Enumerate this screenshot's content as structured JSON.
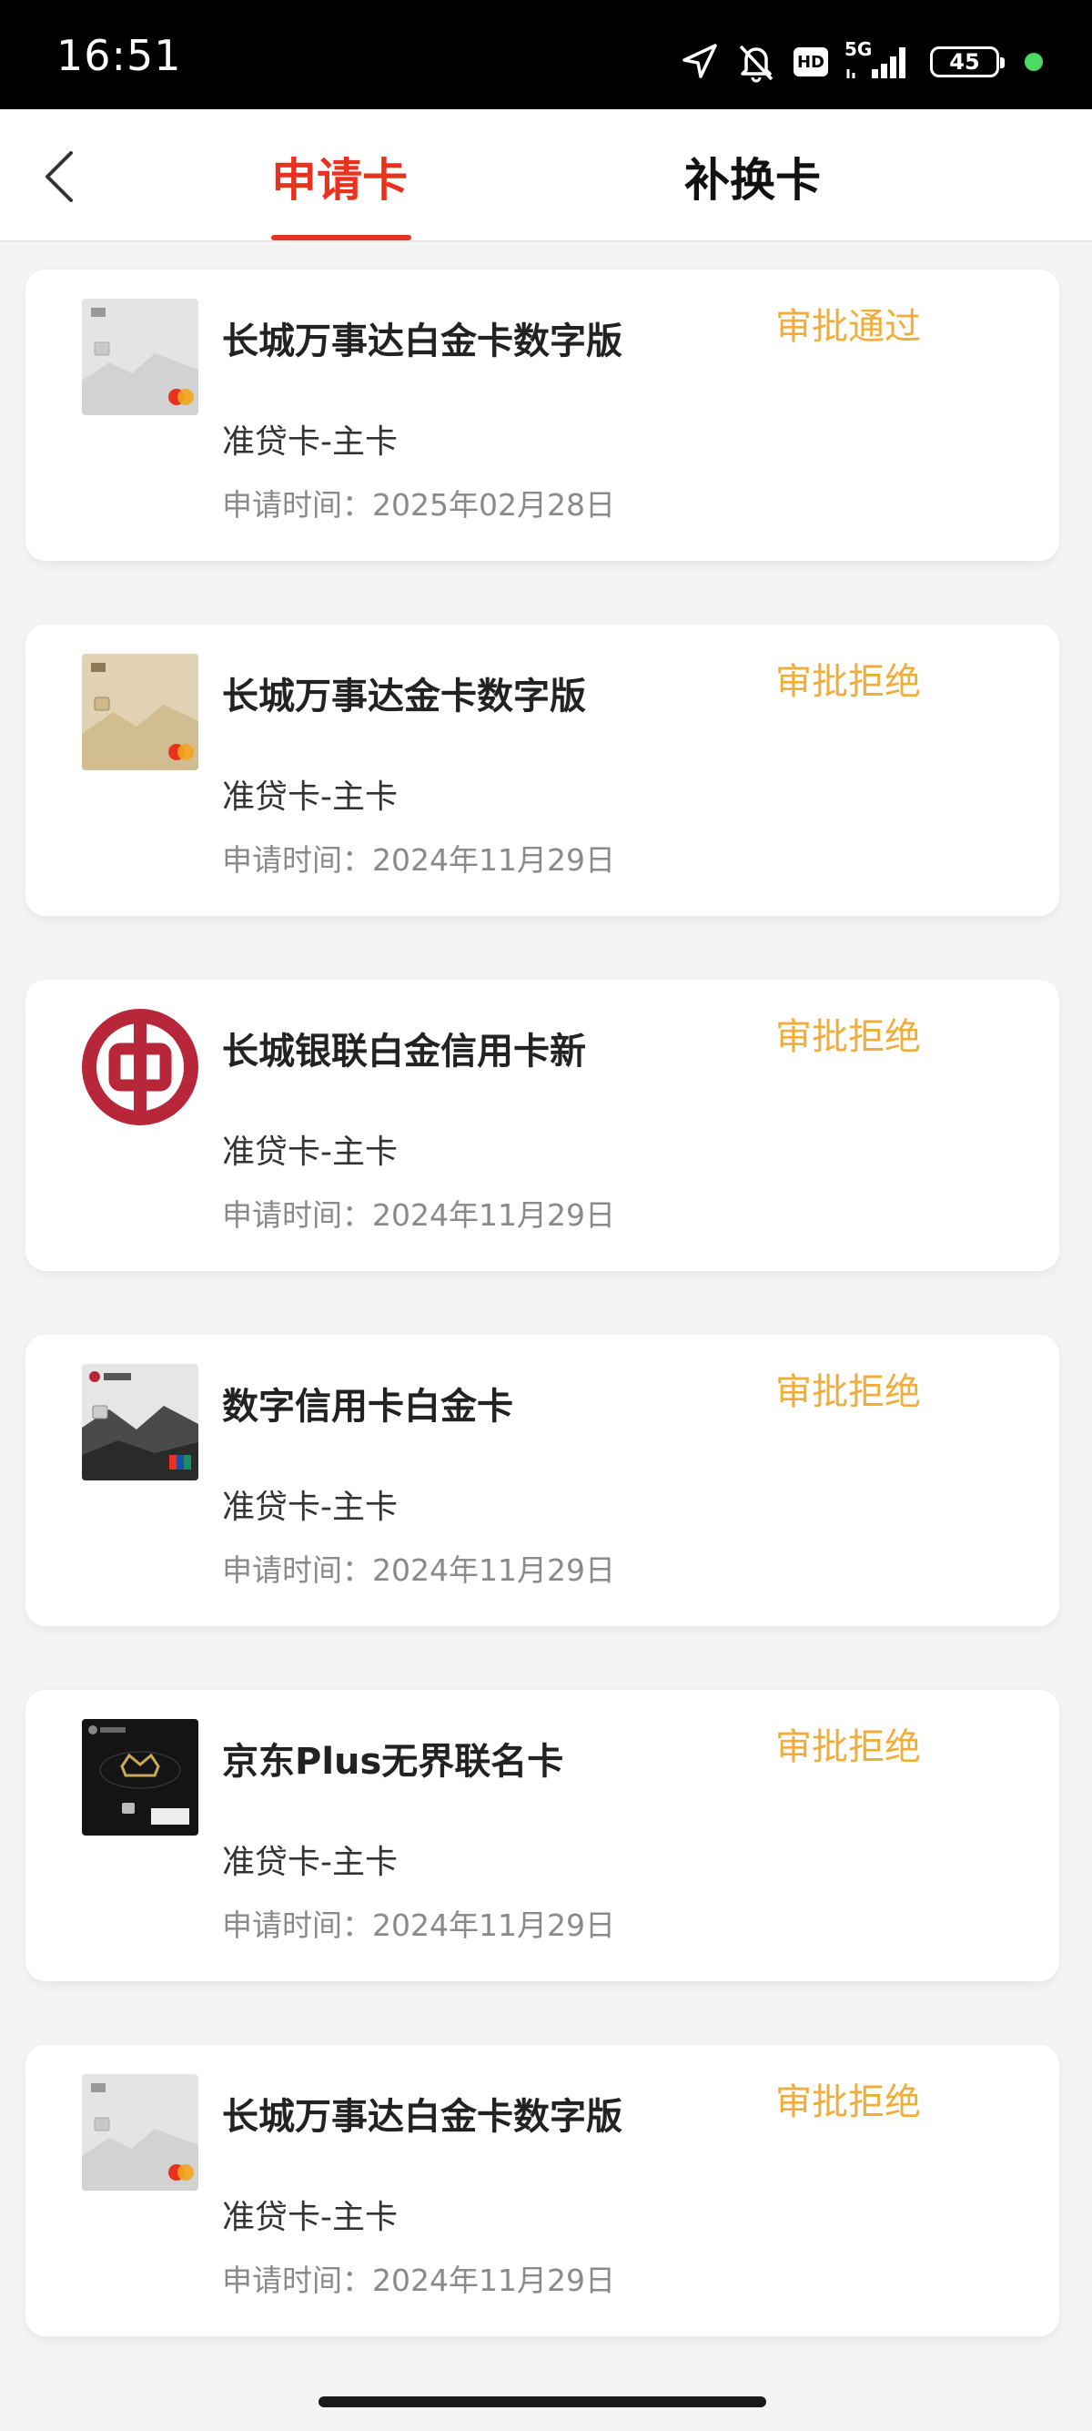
{
  "status_bar": {
    "time": "16:51",
    "hd": "HD",
    "network": "5G",
    "battery": "45",
    "dot_color": "#4cd964"
  },
  "header": {
    "tabs": [
      {
        "label": "申请卡",
        "active": true
      },
      {
        "label": "补换卡",
        "active": false
      }
    ],
    "active_color": "#e8321d"
  },
  "status_colors": {
    "approved": "#f0ad3c",
    "rejected": "#f0ad3c"
  },
  "cards": [
    {
      "name": "长城万事达白金卡数字版",
      "status": "审批通过",
      "type": "准贷卡-主卡",
      "date": "申请时间：2025年02月28日",
      "thumb": "mastercard-platinum-card-icon"
    },
    {
      "name": "长城万事达金卡数字版",
      "status": "审批拒绝",
      "type": "准贷卡-主卡",
      "date": "申请时间：2024年11月29日",
      "thumb": "mastercard-gold-card-icon"
    },
    {
      "name": "长城银联白金信用卡新",
      "status": "审批拒绝",
      "type": "准贷卡-主卡",
      "date": "申请时间：2024年11月29日",
      "thumb": "bank-of-china-logo-icon"
    },
    {
      "name": "数字信用卡白金卡",
      "status": "审批拒绝",
      "type": "准贷卡-主卡",
      "date": "申请时间：2024年11月29日",
      "thumb": "unionpay-digital-card-icon"
    },
    {
      "name": "京东Plus无界联名卡",
      "status": "审批拒绝",
      "type": "准贷卡-主卡",
      "date": "申请时间：2024年11月29日",
      "thumb": "jd-plus-card-icon"
    },
    {
      "name": "长城万事达白金卡数字版",
      "status": "审批拒绝",
      "type": "准贷卡-主卡",
      "date": "申请时间：2024年11月29日",
      "thumb": "mastercard-platinum-card-icon"
    }
  ]
}
